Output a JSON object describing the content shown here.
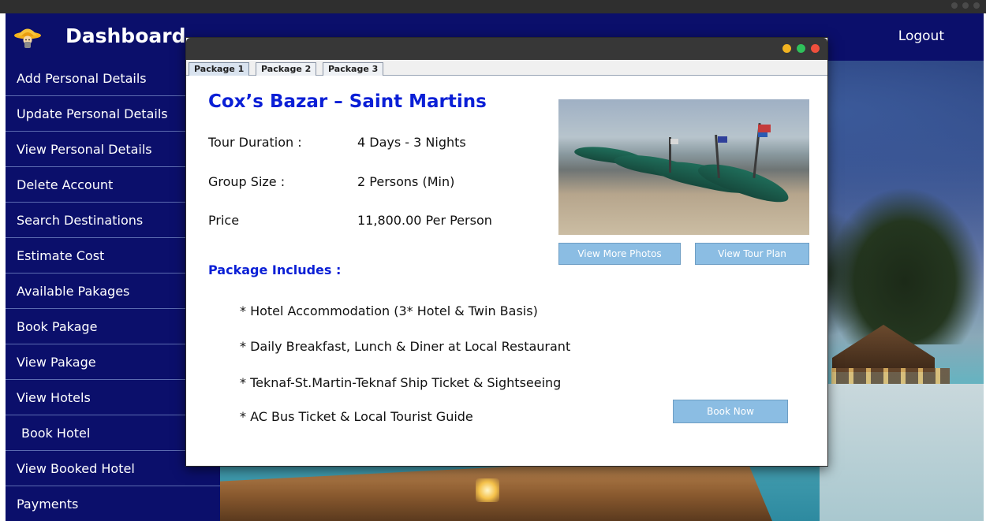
{
  "header": {
    "title": "Dashboard",
    "logout_label": "Logout"
  },
  "sidebar": {
    "items": [
      {
        "label": "Add Personal Details"
      },
      {
        "label": "Update Personal Details"
      },
      {
        "label": "View Personal Details"
      },
      {
        "label": "Delete Account"
      },
      {
        "label": "Search Destinations"
      },
      {
        "label": "Estimate Cost"
      },
      {
        "label": "Available Pakages"
      },
      {
        "label": "Book Pakage"
      },
      {
        "label": "View Pakage"
      },
      {
        "label": "View Hotels"
      },
      {
        "label": "Book Hotel"
      },
      {
        "label": "View Booked Hotel"
      },
      {
        "label": "Payments"
      }
    ]
  },
  "dialog": {
    "tabs": [
      {
        "label": "Package 1",
        "active": true
      },
      {
        "label": "Package 2",
        "active": false
      },
      {
        "label": "Package 3",
        "active": false
      }
    ],
    "package": {
      "title": "Cox’s Bazar – Saint Martins",
      "duration_label": "Tour Duration :",
      "duration_value": "4 Days - 3 Nights",
      "group_label": "Group Size :",
      "group_value": "2 Persons (Min)",
      "price_label": "Price",
      "price_value": "11,800.00 Per Person",
      "includes_title": "Package Includes :",
      "includes": [
        "* Hotel Accommodation (3* Hotel & Twin Basis)",
        "* Daily Breakfast, Lunch & Diner at Local Restaurant",
        "* Teknaf-St.Martin-Teknaf Ship Ticket & Sightseeing",
        "* AC Bus Ticket & Local Tourist Guide"
      ],
      "buttons": {
        "view_photos": "View More Photos",
        "view_plan": "View Tour Plan",
        "book_now": "Book Now"
      }
    }
  },
  "colors": {
    "navy": "#0b0f6b",
    "title_blue": "#0a1fd6",
    "button_blue": "#8bbde3",
    "dot_yellow": "#f1b321",
    "dot_green": "#2fc15b",
    "dot_red": "#ef4f3d"
  },
  "icons": {
    "logo": "traveler-hat-icon",
    "window_controls": [
      "minimize-dot-icon",
      "maximize-dot-icon",
      "close-dot-icon"
    ]
  }
}
